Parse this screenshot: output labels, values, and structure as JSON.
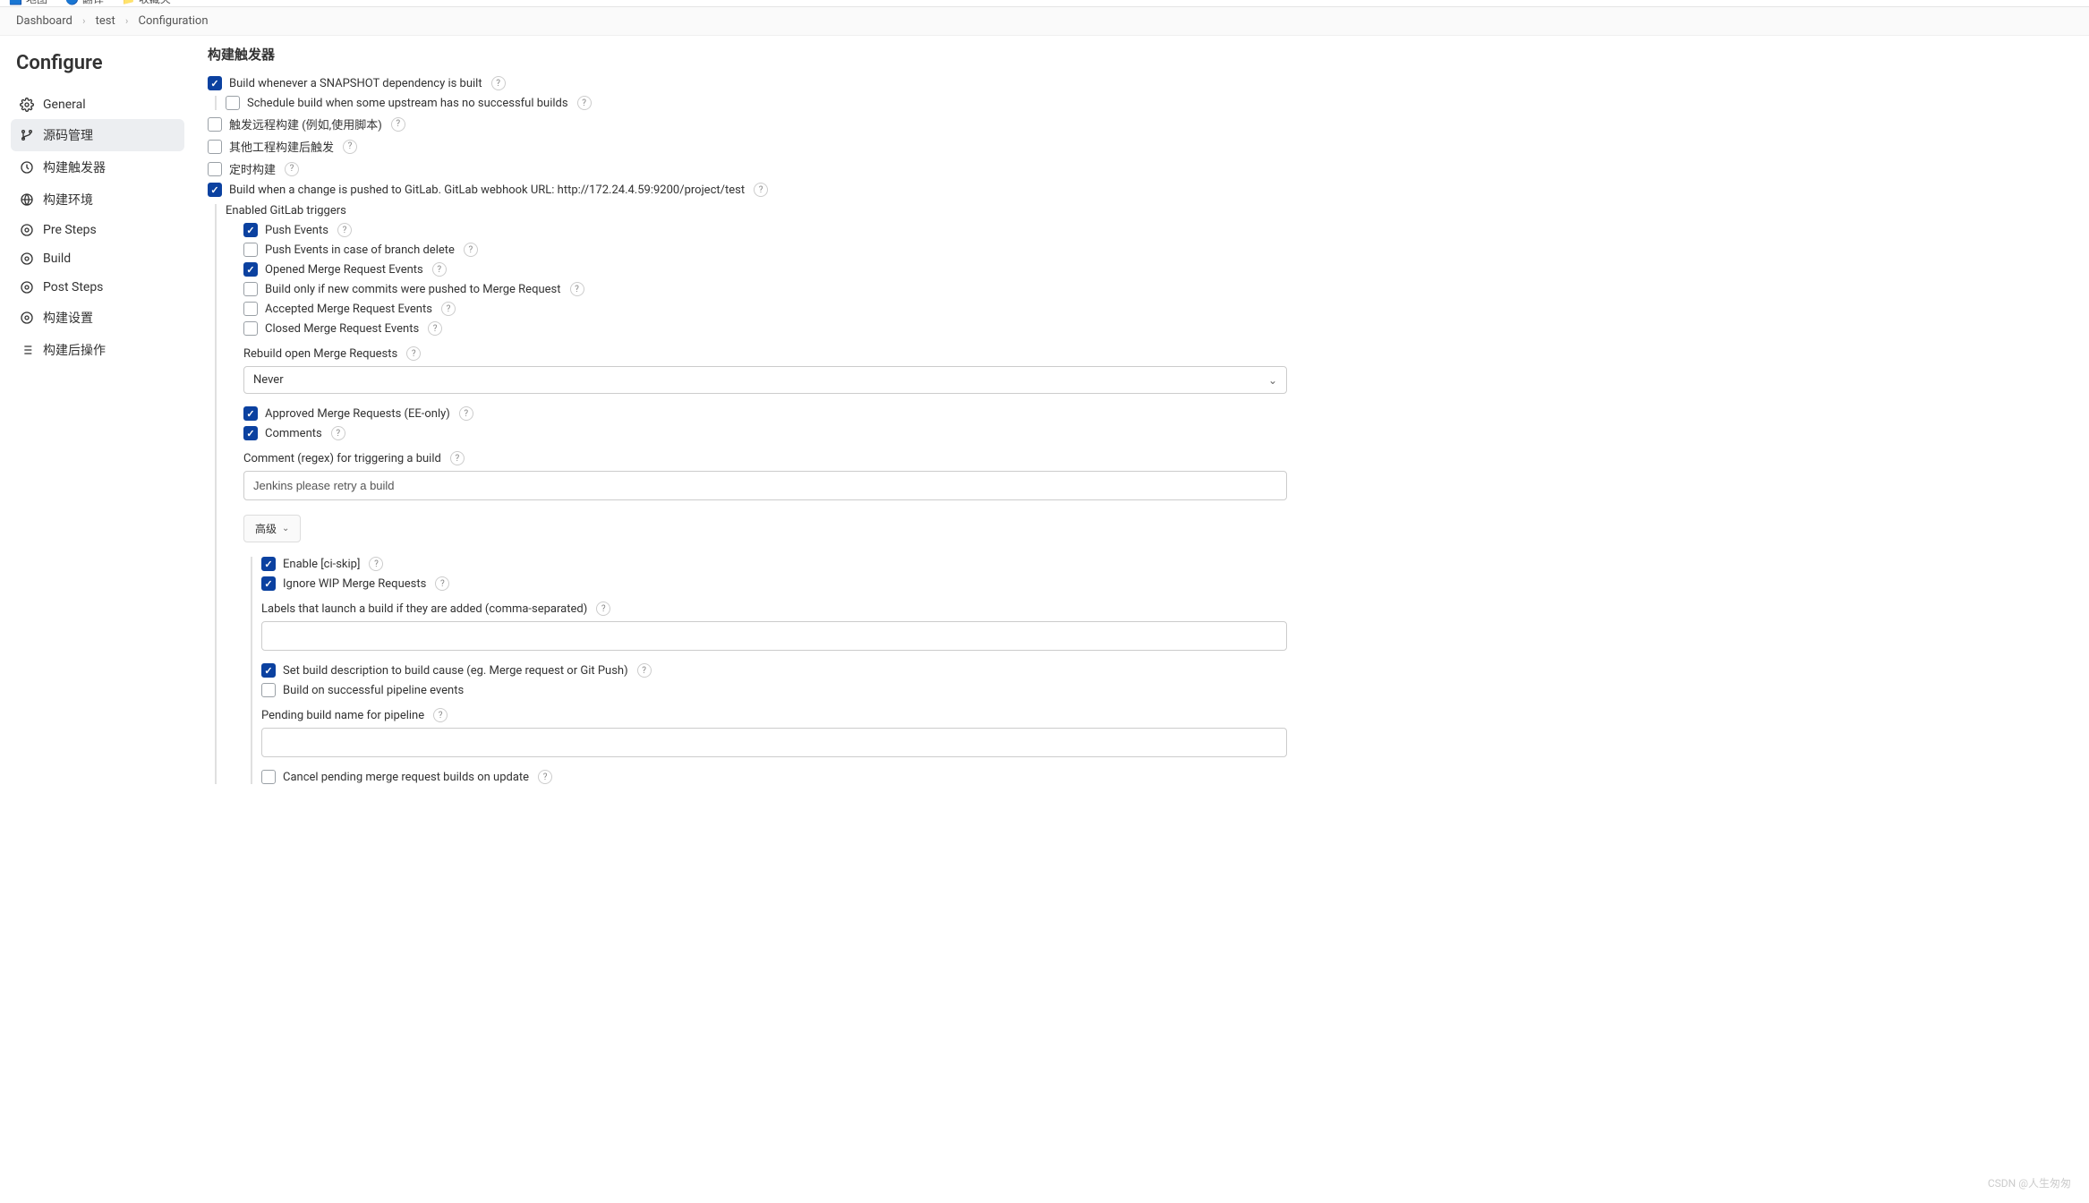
{
  "topbar": {
    "item1": "地图",
    "item2": "翻译",
    "item3": "收藏夹"
  },
  "breadcrumbs": {
    "a": "Dashboard",
    "b": "test",
    "c": "Configuration"
  },
  "sidebar": {
    "title": "Configure",
    "items": [
      {
        "label": "General"
      },
      {
        "label": "源码管理"
      },
      {
        "label": "构建触发器"
      },
      {
        "label": "构建环境"
      },
      {
        "label": "Pre Steps"
      },
      {
        "label": "Build"
      },
      {
        "label": "Post Steps"
      },
      {
        "label": "构建设置"
      },
      {
        "label": "构建后操作"
      }
    ]
  },
  "section": {
    "title": "构建触发器",
    "snapshot": "Build whenever a SNAPSHOT dependency is built",
    "schedule_upstream": "Schedule build when some upstream has no successful builds",
    "remote_trigger": "触发远程构建 (例如,使用脚本)",
    "other_build": "其他工程构建后触发",
    "timed_build": "定时构建",
    "gitlab_push": "Build when a change is pushed to GitLab. GitLab webhook URL: http://172.24.4.59:9200/project/test",
    "enabled_triggers": "Enabled GitLab triggers",
    "push_events": "Push Events",
    "push_delete": "Push Events in case of branch delete",
    "opened_mr": "Opened Merge Request Events",
    "build_only_new": "Build only if new commits were pushed to Merge Request",
    "accepted_mr": "Accepted Merge Request Events",
    "closed_mr": "Closed Merge Request Events",
    "rebuild_label": "Rebuild open Merge Requests",
    "rebuild_value": "Never",
    "approved_mr": "Approved Merge Requests (EE-only)",
    "comments": "Comments",
    "comment_regex_label": "Comment (regex) for triggering a build",
    "comment_regex_value": "Jenkins please retry a build",
    "advanced": "高级",
    "enable_ci_skip": "Enable [ci-skip]",
    "ignore_wip": "Ignore WIP Merge Requests",
    "labels_launch": "Labels that launch a build if they are added (comma-separated)",
    "set_build_desc": "Set build description to build cause (eg. Merge request or Git Push)",
    "build_on_success": "Build on successful pipeline events",
    "pending_name": "Pending build name for pipeline",
    "cancel_pending": "Cancel pending merge request builds on update"
  },
  "watermark": "CSDN @人生匆匆"
}
